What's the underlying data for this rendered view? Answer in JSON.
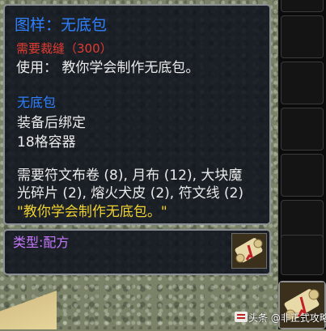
{
  "tooltip": {
    "title": "图样：无底包",
    "requirement": "需要裁缝（300）",
    "use_text": "使用： 教你学会制作无底包。",
    "item_name": "无底包",
    "bind_text": "装备后绑定",
    "container_text": "18格容器",
    "materials_line1": "需要符文布卷 (8), 月布 (12), 大块魔",
    "materials_line2": "光碎片 (2), 熔火犬皮 (2), 符文线 (2)",
    "quote": "\"教你学会制作无底包。\"",
    "type_label": "类型:配方",
    "icon": "recipe-scroll-icon"
  },
  "sidebar": {
    "slot_count": 7,
    "active_slot_icon": "recipe-scroll-icon"
  },
  "watermark": {
    "text": "头条 @非正式攻略"
  },
  "colors": {
    "title": "#2f80ff",
    "requirement": "#e23c32",
    "quote": "#f0d232",
    "type": "#c878ff"
  }
}
